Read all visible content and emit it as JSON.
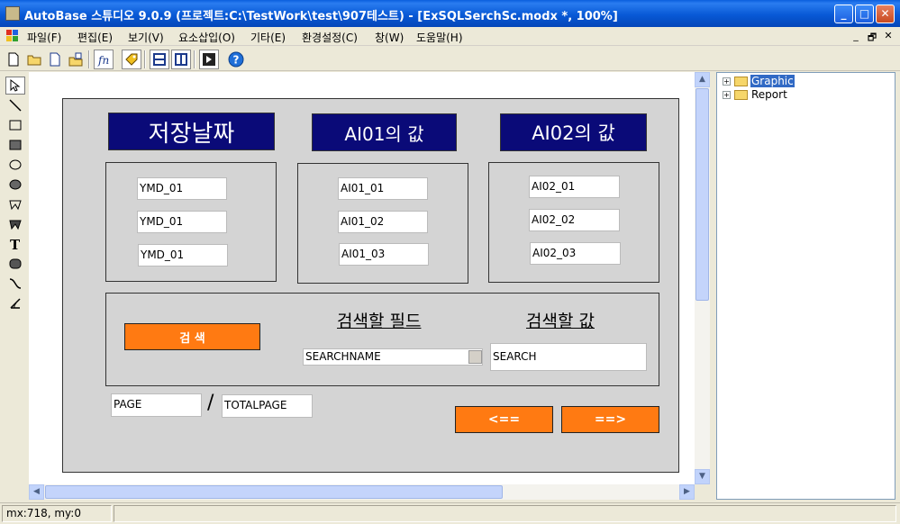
{
  "window": {
    "title": "AutoBase 스튜디오 9.0.9 (프로젝트:C:\\TestWork\\test\\907테스트) - [ExSQLSerchSc.modx *, 100%]",
    "minimize": "_",
    "maximize": "□",
    "close": "✕"
  },
  "menu": {
    "items": [
      "파일(F)",
      "편집(E)",
      "보기(V)",
      "요소삽입(O)",
      "기타(E)",
      "환경설정(C)",
      "창(W)",
      "도움말(H)"
    ],
    "mdi_min": "_",
    "mdi_restore": "🗗",
    "mdi_close": "✕"
  },
  "form": {
    "headers": [
      "저장날짜",
      "AI01의 값",
      "AI02의 값"
    ],
    "col1": [
      "YMD_01",
      "YMD_01",
      "YMD_01"
    ],
    "col2": [
      "AI01_01",
      "AI01_02",
      "AI01_03"
    ],
    "col3": [
      "AI02_01",
      "AI02_02",
      "AI02_03"
    ],
    "search_button": "검  색",
    "search_field_label": "검색할 필드",
    "search_value_label": "검색할 값",
    "search_name": "SEARCHNAME",
    "search_value": "SEARCH",
    "page": "PAGE",
    "page_sep": "/",
    "total_page": "TOTALPAGE",
    "prev_button": "<==",
    "next_button": "==>"
  },
  "tree": {
    "items": [
      "Graphic",
      "Report"
    ]
  },
  "status": {
    "coords": "mx:718, my:0"
  },
  "colors": {
    "header_bg": "#0a0a78",
    "button_orange": "#ff7a12",
    "title_blue": "#0859d6"
  }
}
